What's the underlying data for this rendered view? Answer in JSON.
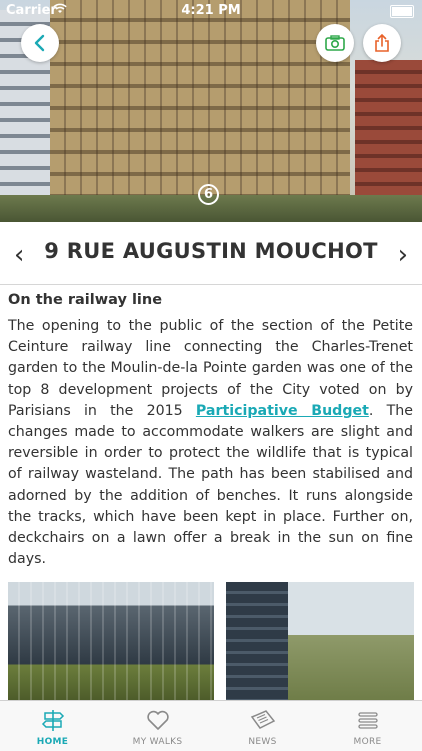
{
  "status_bar": {
    "carrier": "Carrier",
    "time": "4:21 PM"
  },
  "hero": {
    "step_number": "6"
  },
  "header": {
    "title": "9 RUE AUGUSTIN MOUCHOT",
    "prev_glyph": "‹",
    "next_glyph": "›"
  },
  "section": {
    "subtitle": "On the railway line",
    "text_before_link": "The opening to the public of the section of the Petite Ceinture railway line connecting the Charles-Trenet garden to the Moulin-de-la Pointe garden was one of the top 8 development projects of the City voted on by Parisians in the 2015 ",
    "link_text": "Participative Budget",
    "text_after_link": ". The changes made to accommodate walkers are slight and reversible in order to protect the wildlife that is typical of railway wasteland. The path has been stabilised and adorned by the addition of benches. It runs alongside the tracks, which have been kept in place. Further on, deckchairs on a lawn offer a break in the sun on fine days."
  },
  "tabs": [
    {
      "label": "HOME",
      "icon": "signpost-icon",
      "active": true
    },
    {
      "label": "MY WALKS",
      "icon": "heart-icon",
      "active": false
    },
    {
      "label": "NEWS",
      "icon": "newspaper-icon",
      "active": false
    },
    {
      "label": "MORE",
      "icon": "menu-icon",
      "active": false
    }
  ],
  "colors": {
    "accent": "#1aa9b5",
    "camera": "#2ea84a",
    "share": "#e8622a",
    "text": "#333333"
  }
}
